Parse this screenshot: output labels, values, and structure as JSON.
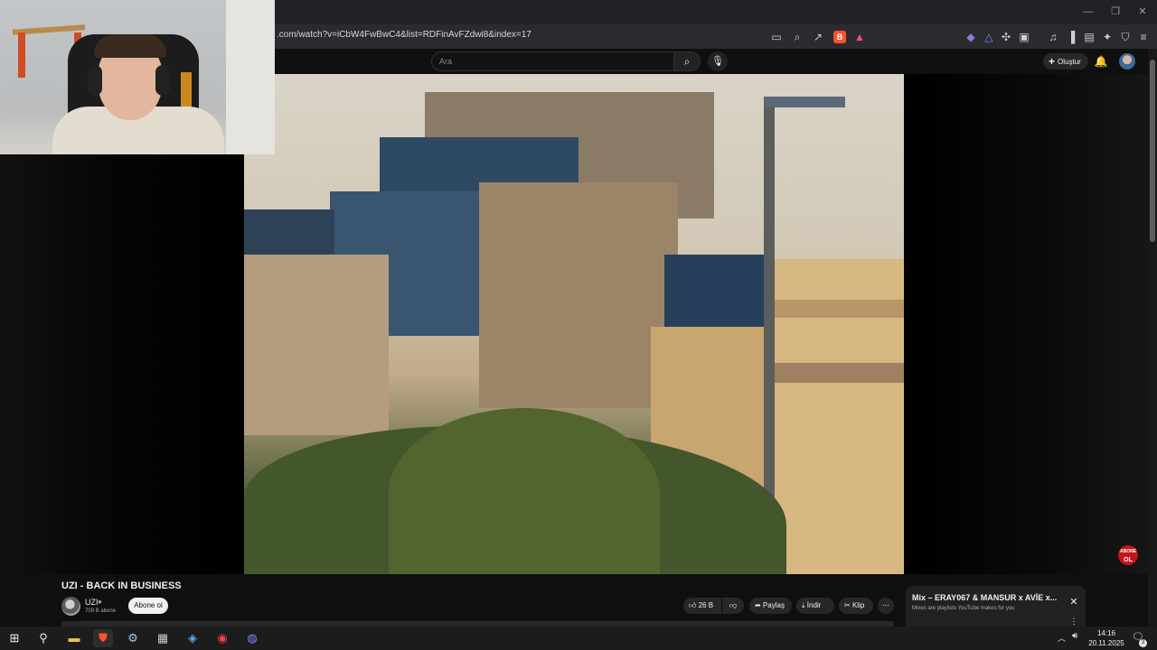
{
  "browser": {
    "url": ".com/watch?v=iCbW4FwBwC4&list=RDFinAvFZdwi8&index=17",
    "brave_badge": "▲"
  },
  "youtube": {
    "search_placeholder": "Ara",
    "create_label": "Oluştur"
  },
  "video": {
    "title": "UZI - BACK IN BUSINESS",
    "channel_name": "UZI",
    "subscribers": "709 B abone",
    "subscribe_label": "Abone ol",
    "likes": "26 B",
    "share_label": "Paylaş",
    "download_label": "İndir",
    "clip_label": "Klip",
    "watermark_line1": "ABONE",
    "watermark_line2": "OL"
  },
  "mix": {
    "title": "Mix – ERAY067 & MANSUR x AVİE x...",
    "subtitle": "Mixes are playlists YouTube makes for you"
  },
  "taskbar": {
    "time": "14:16",
    "date": "20.11.2025",
    "notification_count": "3"
  },
  "colors": {
    "youtube_bg": "#0f0f0f",
    "taskbar_bg": "#1c1c1c",
    "brave_orange": "#fb542b"
  }
}
